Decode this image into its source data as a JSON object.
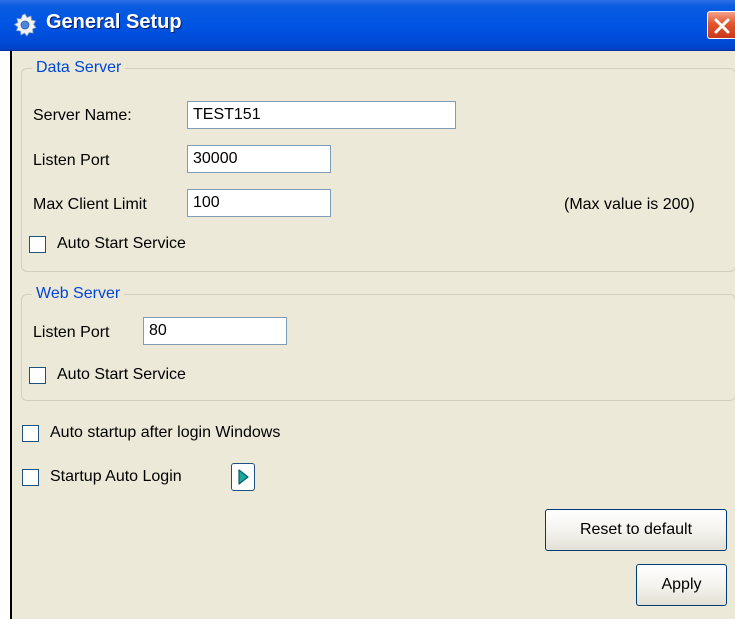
{
  "window": {
    "title": "General Setup",
    "icon": "gear-icon",
    "close_icon": "close-icon"
  },
  "data_server": {
    "legend": "Data Server",
    "server_name_label": "Server Name:",
    "server_name_value": "TEST151",
    "listen_port_label": "Listen Port",
    "listen_port_value": "30000",
    "max_client_label": "Max Client Limit",
    "max_client_value": "100",
    "max_hint": "(Max value is 200)",
    "auto_start_label": "Auto Start Service",
    "auto_start_checked": false
  },
  "web_server": {
    "legend": "Web Server",
    "listen_port_label": "Listen Port",
    "listen_port_value": "80",
    "auto_start_label": "Auto Start Service",
    "auto_start_checked": false
  },
  "options": {
    "auto_startup_label": "Auto startup after login Windows",
    "auto_startup_checked": false,
    "auto_login_label": "Startup Auto Login",
    "auto_login_checked": false,
    "auto_login_button_icon": "play-icon"
  },
  "buttons": {
    "reset_label": "Reset to default",
    "apply_label": "Apply"
  }
}
